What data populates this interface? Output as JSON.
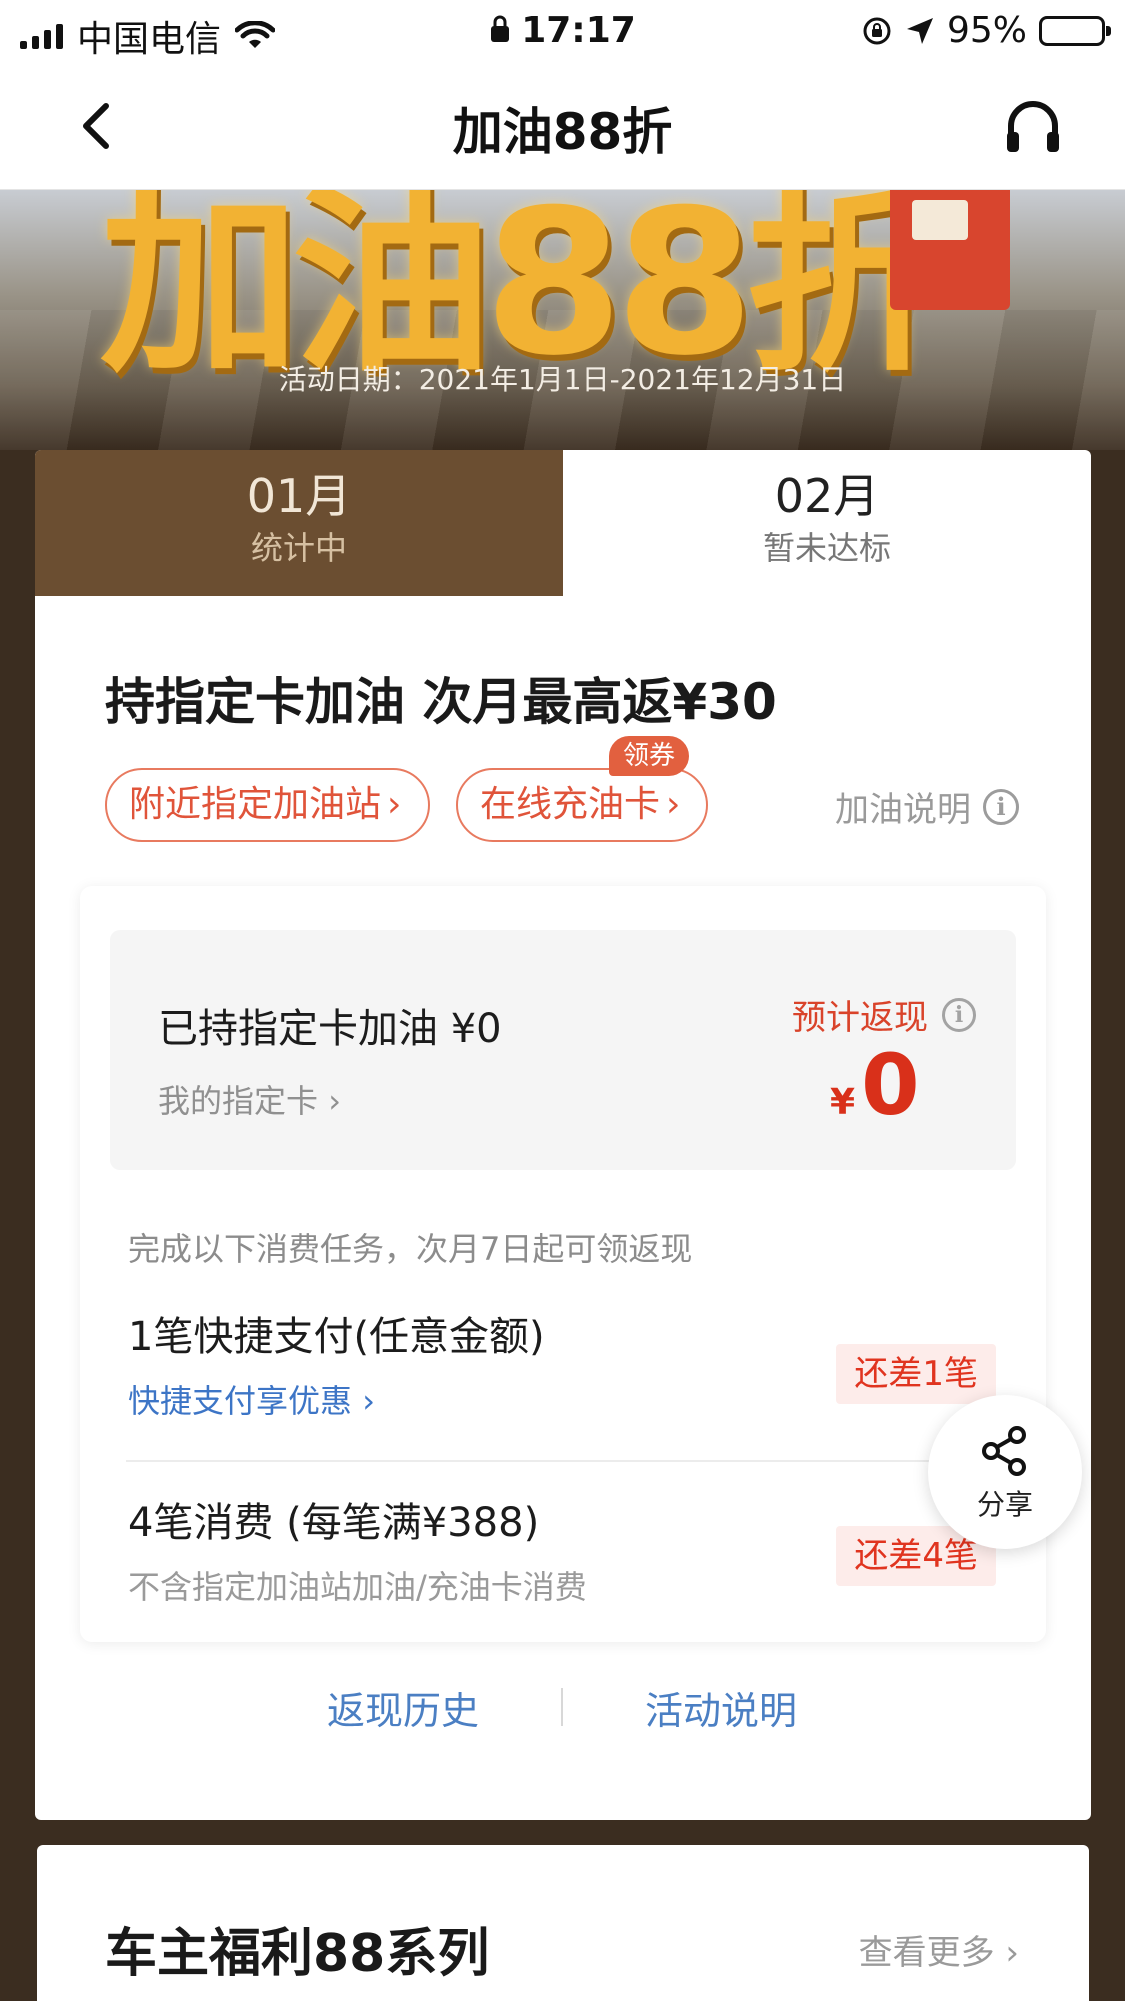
{
  "status_bar": {
    "carrier": "中国电信",
    "time": "17:17",
    "battery": "95%",
    "battery_level": 0.95
  },
  "nav": {
    "title": "加油88折"
  },
  "banner": {
    "headline": "加油88折",
    "date": "活动日期：2021年1月1日-2021年12月31日"
  },
  "tabs": [
    {
      "month": "01月",
      "status": "统计中",
      "active": true
    },
    {
      "month": "02月",
      "status": "暂未达标",
      "active": false
    }
  ],
  "promo": {
    "headline": "持指定卡加油 次月最高返¥30",
    "nearby_button": "附近指定加油站",
    "online_button": "在线充油卡",
    "coupon_badge": "领券",
    "explain_link": "加油说明"
  },
  "stats": {
    "refueled": "已持指定卡加油 ¥0",
    "my_card": "我的指定卡",
    "estimated_label": "预计返现",
    "currency": "¥",
    "estimated_amount": "0"
  },
  "tasks": {
    "tip": "完成以下消费任务，次月7日起可领返现",
    "items": [
      {
        "title": "1笔快捷支付(任意金额)",
        "subtitle": "快捷支付享优惠",
        "badge": "还差1笔"
      },
      {
        "title": "4笔消费 (每笔满¥388)",
        "subtitle": "不含指定加油站加油/充油卡消费",
        "badge": "还差4笔"
      }
    ]
  },
  "share": {
    "label": "分享"
  },
  "links": {
    "history": "返现历史",
    "rules": "活动说明"
  },
  "series": {
    "title": "车主福利88系列",
    "more": "查看更多"
  },
  "colors": {
    "tab_active": "#6b4e31",
    "accent_red": "#e0543a",
    "link_blue": "#4b7fc3",
    "background": "#3b2d20"
  }
}
